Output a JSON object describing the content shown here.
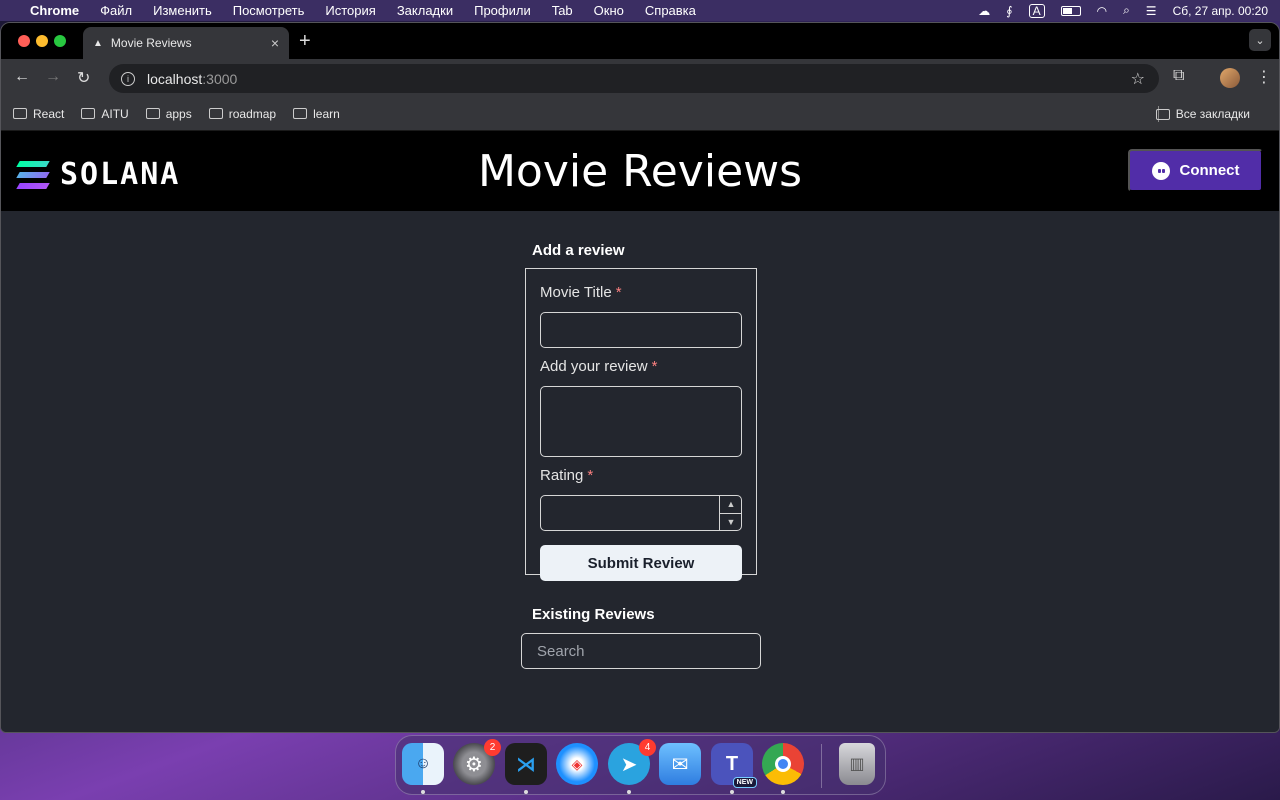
{
  "menubar": {
    "items": [
      "Chrome",
      "Файл",
      "Изменить",
      "Посмотреть",
      "История",
      "Закладки",
      "Профили",
      "Tab",
      "Окно",
      "Справка"
    ],
    "datetime": "Сб, 27 апр. 00:20",
    "keyboard": "A"
  },
  "browser": {
    "tab_title": "Movie Reviews",
    "url_host": "localhost",
    "url_port": ":3000",
    "bookmarks": [
      "React",
      "AITU",
      "apps",
      "roadmap",
      "learn"
    ],
    "all_bookmarks": "Все закладки"
  },
  "app": {
    "logo_text": "SOLANA",
    "title": "Movie Reviews",
    "connect_label": "Connect"
  },
  "form": {
    "heading": "Add a review",
    "title_label": "Movie Title",
    "review_label": "Add your review",
    "rating_label": "Rating",
    "required_mark": "*",
    "title_value": "",
    "review_value": "",
    "rating_value": "",
    "submit_label": "Submit Review"
  },
  "reviews": {
    "heading": "Existing Reviews",
    "search_placeholder": "Search",
    "search_value": ""
  },
  "dock": {
    "apps": [
      {
        "name": "Finder",
        "icon": "finder-icon",
        "running": true
      },
      {
        "name": "System Settings",
        "icon": "settings-icon",
        "badge": "2",
        "running": false
      },
      {
        "name": "Visual Studio Code",
        "icon": "vscode-icon",
        "running": true
      },
      {
        "name": "Safari",
        "icon": "safari-icon",
        "running": false
      },
      {
        "name": "Telegram",
        "icon": "telegram-icon",
        "badge": "4",
        "running": true
      },
      {
        "name": "Mail",
        "icon": "mail-icon",
        "running": false
      },
      {
        "name": "Microsoft Teams",
        "icon": "teams-icon",
        "badge": "NEW",
        "running": true
      },
      {
        "name": "Chrome",
        "icon": "chrome-icon",
        "running": true
      },
      {
        "name": "Trash",
        "icon": "trash-icon",
        "running": false
      }
    ]
  },
  "colors": {
    "connect_bg": "#512da8",
    "required": "#fc8181",
    "page_bg": "#23262e",
    "header_bg": "#000000"
  }
}
